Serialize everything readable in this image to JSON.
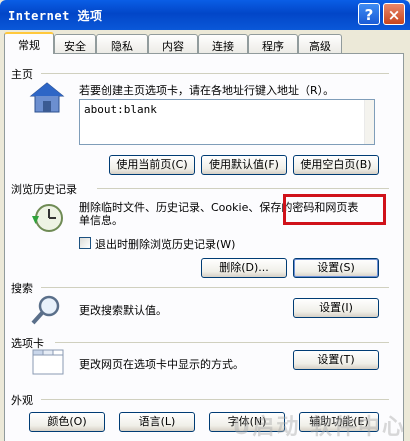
{
  "window": {
    "title": "Internet 选项",
    "help": "?",
    "close": "×"
  },
  "tabs": [
    "常规",
    "安全",
    "隐私",
    "内容",
    "连接",
    "程序",
    "高级"
  ],
  "homepage": {
    "title": "主页",
    "hint": "若要创建主页选项卡，请在各地址行键入地址（R）。",
    "value": "about:blank",
    "use_current": "使用当前页(C)",
    "use_default": "使用默认值(F)",
    "use_blank": "使用空白页(B)"
  },
  "history": {
    "title": "浏览历史记录",
    "desc": "删除临时文件、历史记录、Cookie、保存的密码和网页表单信息。",
    "checkbox_label": "退出时删除浏览历史记录(W)",
    "delete_btn": "删除(D)...",
    "settings_btn": "设置(S)"
  },
  "search": {
    "title": "搜索",
    "desc": "更改搜索默认值。",
    "settings_btn": "设置(I)"
  },
  "tabs_section": {
    "title": "选项卡",
    "desc": "更改网页在选项卡中显示的方式。",
    "settings_btn": "设置(T)"
  },
  "appearance": {
    "title": "外观",
    "colors_btn": "颜色(O)",
    "languages_btn": "语言(L)",
    "fonts_btn": "字体(N)",
    "accessibility_btn": "辅助功能(E)"
  },
  "watermark": "U启动 软件中心",
  "colors": {
    "title_bar": "#0a5ee6",
    "highlight": "#d0121a"
  }
}
